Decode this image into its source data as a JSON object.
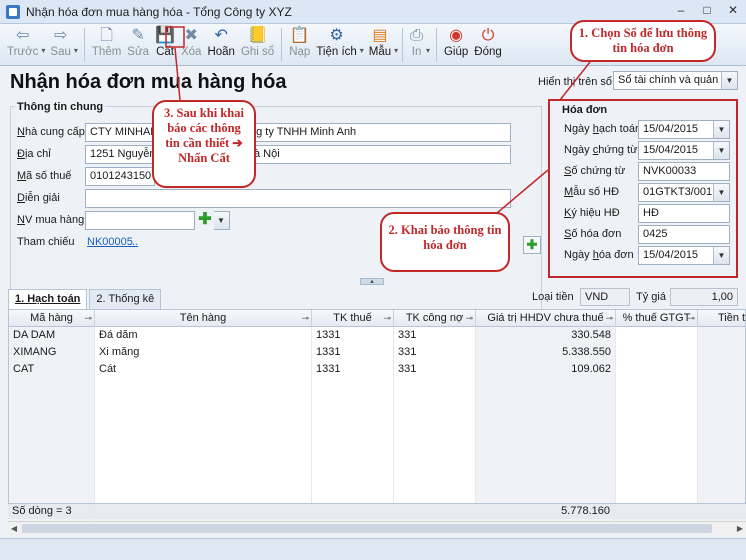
{
  "window": {
    "title": "Nhận hóa đơn mua hàng hóa - Tổng Công ty XYZ",
    "controls": [
      "–",
      "□",
      "✕"
    ]
  },
  "toolbar": {
    "prev": "Trước",
    "next": "Sau",
    "add": "Thêm",
    "edit": "Sửa",
    "save": "Cất",
    "delete": "Xóa",
    "undo": "Hoãn",
    "post": "Ghi sổ",
    "load": "Nạp",
    "utilities": "Tiện ích",
    "template": "Mẫu",
    "print": "In",
    "help": "Giúp",
    "close": "Đóng"
  },
  "page": {
    "title": "Nhận hóa đơn mua hàng hóa",
    "display_label": "Hiển thị trên sổ",
    "display_value": "Sổ tài chính và quản trị"
  },
  "general": {
    "section_title": "Thông tin chung",
    "supplier_label": "Nhà cung cấp",
    "supplier_code": "CTY MINHANH",
    "supplier_name": "ng ty TNHH Minh Anh",
    "address_label": "Địa chỉ",
    "address_value": "1251 Nguyễn K",
    "address_tail": "à Nội",
    "tax_label": "Mã số thuế",
    "tax_value": "0101243150",
    "desc_label": "Diễn giải",
    "desc_value": "",
    "staff_label": "NV mua hàng",
    "staff_value": "",
    "ref_label": "Tham chiếu",
    "ref_value": "NK00005",
    "ref_more": "..."
  },
  "invoice": {
    "section_title": "Hóa đơn",
    "posting_date_label": "Ngày hạch toán",
    "posting_date": "15/04/2015",
    "voucher_date_label": "Ngày chứng từ",
    "voucher_date": "15/04/2015",
    "voucher_no_label": "Số chứng từ",
    "voucher_no": "NVK00033",
    "form_label": "Mẫu số HĐ",
    "form_value": "01GTKT3/001",
    "symbol_label": "Ký hiệu HĐ",
    "symbol_value": "HĐ",
    "invoice_no_label": "Số hóa đơn",
    "invoice_no": "0425",
    "invoice_date_label": "Ngày hóa đơn",
    "invoice_date": "15/04/2015"
  },
  "tabs": {
    "accounting": "1. Hạch toán",
    "stats": "2. Thống kê"
  },
  "currency": {
    "label": "Loại tiền",
    "value": "VND",
    "rate_label": "Tỷ giá",
    "rate_value": "1,00"
  },
  "grid": {
    "headers": [
      "Mã hàng",
      "Tên hàng",
      "TK thuế",
      "TK công nợ",
      "Giá trị HHDV chưa thuế",
      "% thuế GTGT",
      "Tiền th"
    ],
    "rows": [
      {
        "code": "DA DAM",
        "name": "Đá dăm",
        "tax_acc": "1331",
        "debt_acc": "331",
        "value": "330.548"
      },
      {
        "code": "XIMANG",
        "name": "Xi măng",
        "tax_acc": "1331",
        "debt_acc": "331",
        "value": "5.338.550"
      },
      {
        "code": "CAT",
        "name": "Cát",
        "tax_acc": "1331",
        "debt_acc": "331",
        "value": "109.062"
      }
    ],
    "row_count": "Số dòng = 3",
    "total": "5.778.160"
  },
  "callouts": {
    "c1": "1. Chọn Sổ để lưu thông tin hóa đơn",
    "c2": "2. Khai báo thông tin hóa đơn",
    "c3_a": "3. Sau khi khai báo các thông tin cần thiết",
    "c3_arrow": "➔",
    "c3_b": "Nhấn Cất"
  }
}
